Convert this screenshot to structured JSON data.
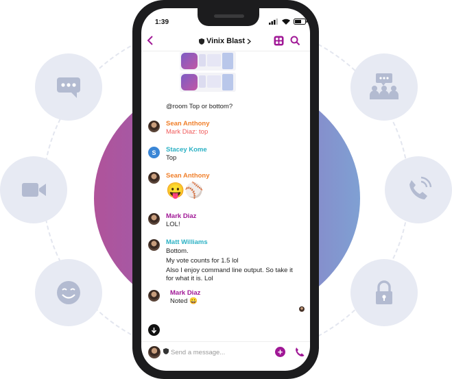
{
  "colors": {
    "accent": "#a01896",
    "name_orange": "#f07f2a",
    "name_purple": "#a01896",
    "name_teal": "#2bb1c4",
    "mention_red": "#f05a5a",
    "feature_circle_bg": "#e7eaf3",
    "feature_icon": "#b3bbd1"
  },
  "features": [
    {
      "icon": "chat-bubble-icon"
    },
    {
      "icon": "video-camera-icon"
    },
    {
      "icon": "smiley-icon"
    },
    {
      "icon": "group-chat-icon"
    },
    {
      "icon": "phone-ring-icon"
    },
    {
      "icon": "lock-icon"
    }
  ],
  "status_bar": {
    "time": "1:39"
  },
  "header": {
    "title": "Vinix Blast"
  },
  "messages": {
    "room_text": "@room Top or bottom?",
    "m1": {
      "author": "Sean Anthony",
      "text": "Mark Diaz: top"
    },
    "m2": {
      "author": "Stacey Kome",
      "avatar_letter": "S",
      "text": "Top"
    },
    "m3": {
      "author": "Sean Anthony",
      "emoji": "😛⚾"
    },
    "m4": {
      "author": "Mark Diaz",
      "text": "LOL!"
    },
    "m5": {
      "author": "Matt Williams",
      "line1": "Bottom.",
      "line2": "My vote counts for 1.5 lol",
      "line3": "Also I enjoy command line output. So take it",
      "line4": "for what it is. Lol"
    },
    "m6": {
      "author": "Mark Diaz",
      "text": "Noted 😀"
    }
  },
  "composer": {
    "placeholder": "Send a message..."
  }
}
